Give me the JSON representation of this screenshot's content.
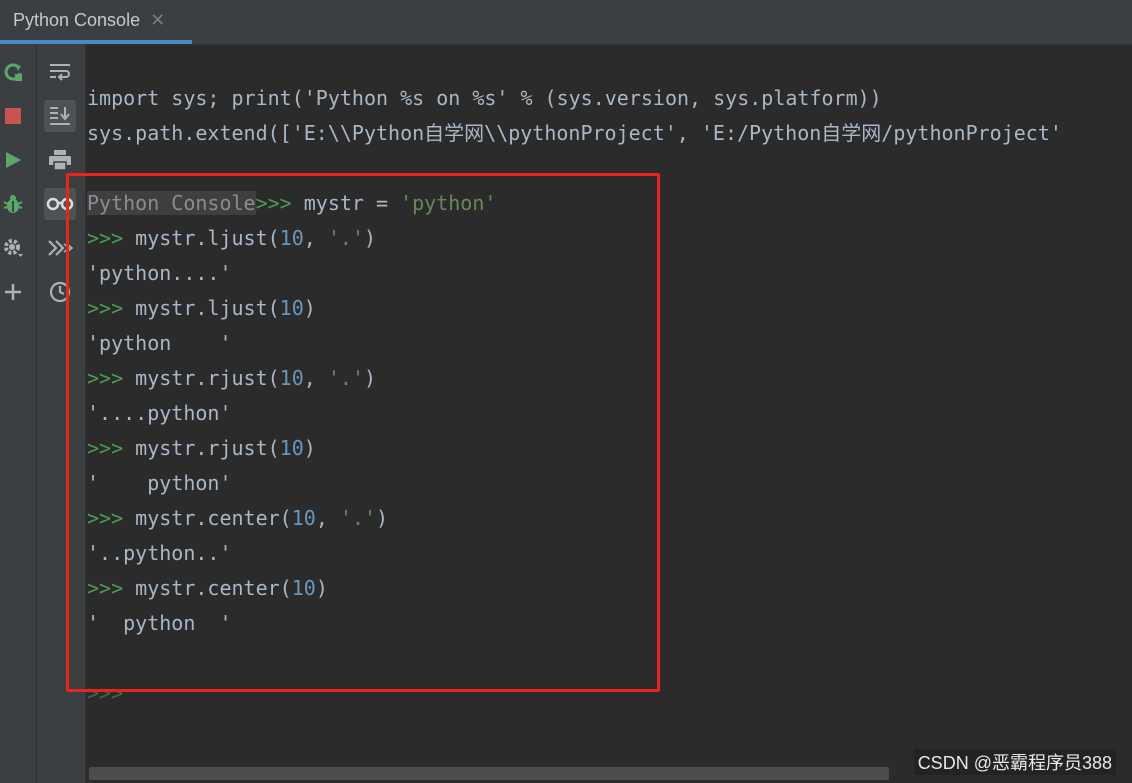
{
  "tab": {
    "title": "Python Console",
    "close_glyph": "✕"
  },
  "left_toolbar": [
    {
      "icon": "rerun-icon",
      "color": "#59a869"
    },
    {
      "icon": "stop-icon",
      "color": "#c75450"
    },
    {
      "icon": "run-icon",
      "color": "#59a869"
    },
    {
      "icon": "debug-icon",
      "color": "#59a869"
    },
    {
      "icon": "settings-icon",
      "color": "#afb1b3"
    },
    {
      "icon": "add-icon",
      "color": "#afb1b3"
    }
  ],
  "right_toolbar": [
    {
      "icon": "soft-wrap-icon"
    },
    {
      "icon": "scroll-to-end-icon",
      "active": true
    },
    {
      "icon": "print-icon"
    },
    {
      "icon": "show-variables-icon",
      "active": true
    },
    {
      "icon": "execute-icon"
    },
    {
      "icon": "history-icon"
    }
  ],
  "console": {
    "header_lines": [
      "import sys; print('Python %s on %s' % (sys.version, sys.platform))",
      "sys.path.extend(['E:\\\\Python自学网\\\\pythonProject', 'E:/Python自学网/pythonProject'"
    ],
    "console_label": "Python Console",
    "prompt": ">>>",
    "first_cmd": {
      "prefix": "mystr = ",
      "str": "'python'"
    },
    "entries": [
      {
        "method": "mystr.ljust(",
        "n": "10",
        "sep": ", ",
        "fill": "'.'",
        "close": ")",
        "output": "'python....'"
      },
      {
        "method": "mystr.ljust(",
        "n": "10",
        "sep": "",
        "fill": "",
        "close": ")",
        "output": "'python    '"
      },
      {
        "method": "mystr.rjust(",
        "n": "10",
        "sep": ", ",
        "fill": "'.'",
        "close": ")",
        "output": "'....python'"
      },
      {
        "method": "mystr.rjust(",
        "n": "10",
        "sep": "",
        "fill": "",
        "close": ")",
        "output": "'    python'"
      },
      {
        "method": "mystr.center(",
        "n": "10",
        "sep": ", ",
        "fill": "'.'",
        "close": ")",
        "output": "'..python..'"
      },
      {
        "method": "mystr.center(",
        "n": "10",
        "sep": "",
        "fill": "",
        "close": ")",
        "output": "'  python  '"
      }
    ],
    "trailing_prompt": ">>>"
  },
  "colors": {
    "background": "#2b2b2b",
    "panel": "#3c3f41",
    "text": "#a9b7c6",
    "prompt": "#499c54",
    "number": "#6897bb",
    "string": "#6a8759",
    "highlight_box": "#e8241c"
  },
  "watermark": "CSDN @恶霸程序员388"
}
